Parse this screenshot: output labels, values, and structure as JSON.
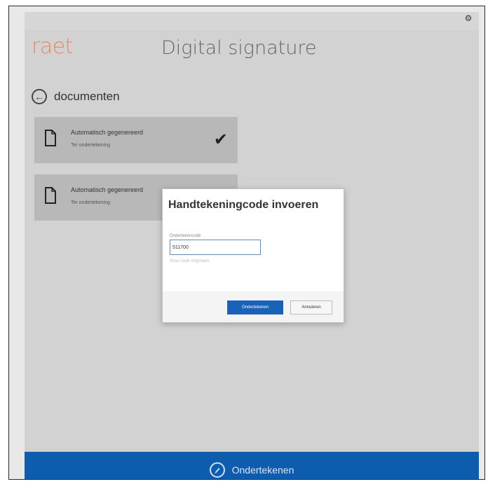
{
  "header": {
    "logo": "raet",
    "title": "Digital signature",
    "settings_icon": "gear-icon"
  },
  "nav": {
    "back_label": "documenten",
    "back_icon": "arrow-left-circle-icon"
  },
  "documents": [
    {
      "title": "Automatisch gegenereerd",
      "status": "Ter ondertekening",
      "signed": true
    },
    {
      "title": "Automatisch gegenereerd",
      "status": "Ter ondertekening",
      "signed": false
    }
  ],
  "dialog": {
    "title": "Handtekeningcode invoeren",
    "field_label": "Ondertekencode",
    "code_value": "511700",
    "resend_link": "Stuur code nogmaals",
    "confirm_label": "Ondertekenen",
    "cancel_label": "Annuleren"
  },
  "footer": {
    "sign_label": "Ondertekenen",
    "sign_icon": "pen-circle-icon"
  },
  "colors": {
    "accent": "#0d5cad",
    "logo": "#e48a6a",
    "primary_button": "#1a62b8"
  }
}
